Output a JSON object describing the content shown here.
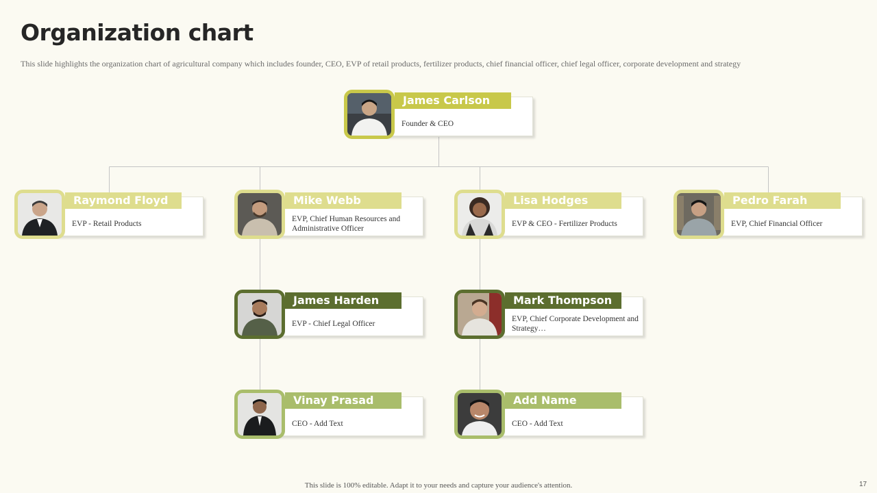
{
  "slide": {
    "title": "Organization chart",
    "subtitle": "This slide highlights the organization chart of agricultural company which includes founder, CEO,  EVP  of retail products, fertilizer  products, chief financial officer,  chief legal officer,  corporate development and strategy",
    "footer": "This slide is 100% editable.  Adapt it to your needs and capture your audience's  attention.",
    "page_number": "17"
  },
  "colors": {
    "ceo": "#c8c84a",
    "level1": "#dedd8e",
    "level2": "#5c6e2f",
    "level3": "#a9bd6b",
    "connector": "#c4c4c4",
    "background": "#fbfaf2"
  },
  "nodes": {
    "ceo": {
      "name": "James Carlson",
      "role": "Founder & CEO",
      "photo_icon": "person-photo-icon"
    },
    "retail": {
      "name": "Raymond Floyd",
      "role": "EVP - Retail Products",
      "photo_icon": "person-photo-icon"
    },
    "hr": {
      "name": "Mike Webb",
      "role": "EVP, Chief Human Resources and Administrative Officer",
      "photo_icon": "person-photo-icon"
    },
    "fertilizer": {
      "name": "Lisa Hodges",
      "role": "EVP & CEO - Fertilizer Products",
      "photo_icon": "person-photo-icon"
    },
    "finance": {
      "name": "Pedro Farah",
      "role": "EVP, Chief Financial  Officer",
      "photo_icon": "person-photo-icon"
    },
    "legal": {
      "name": "James Harden",
      "role": "EVP - Chief Legal  Officer",
      "photo_icon": "person-photo-icon"
    },
    "strategy": {
      "name": "Mark Thompson",
      "role": "EVP, Chief Corporate Development and Strategy…",
      "photo_icon": "person-photo-icon"
    },
    "vinay": {
      "name": "Vinay Prasad",
      "role": "CEO - Add Text",
      "photo_icon": "person-photo-icon"
    },
    "addname": {
      "name": "Add Name",
      "role": "CEO - Add Text",
      "photo_icon": "person-photo-icon"
    }
  }
}
